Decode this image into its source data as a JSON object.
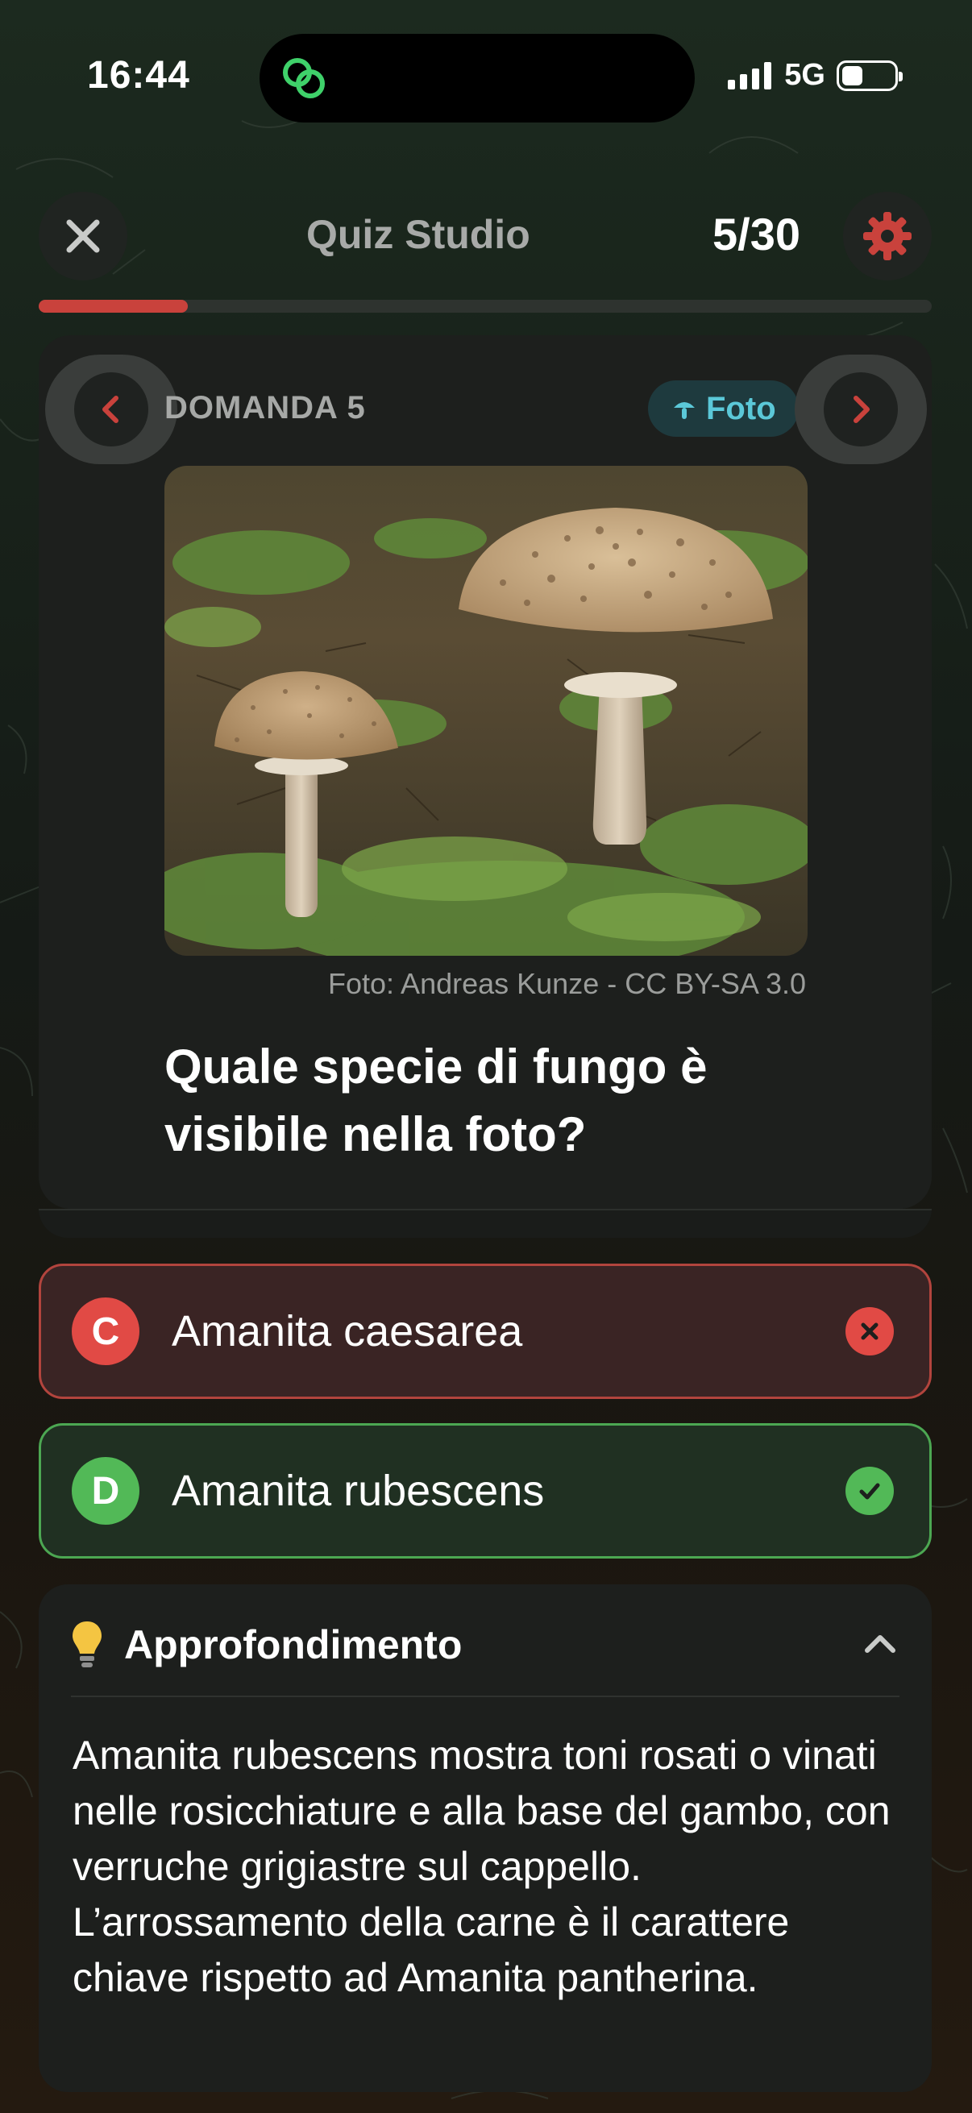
{
  "status_bar": {
    "time": "16:44",
    "network": "5G",
    "island_icon": "link-chain-icon"
  },
  "header": {
    "title": "Quiz Studio",
    "counter": "5/30",
    "close_icon": "close-icon",
    "settings_icon": "gear-icon",
    "progress": 0.167,
    "accent_color": "#c9423c"
  },
  "question_card": {
    "label": "DOMANDA 5",
    "badge": "Foto",
    "badge_icon": "mushroom-icon",
    "photo_credit": "Foto: Andreas Kunze - CC BY-SA 3.0",
    "question": "Quale specie di fungo è visibile nella foto?"
  },
  "answers": [
    {
      "letter": "C",
      "text": "Amanita caesarea",
      "state": "wrong",
      "color": "#e14a45"
    },
    {
      "letter": "D",
      "text": "Amanita rubescens",
      "state": "correct",
      "color": "#52b957"
    }
  ],
  "insight": {
    "icon": "lightbulb-icon",
    "title": "Approfondimento",
    "text": "Amanita rubescens mostra toni rosati o vinati nelle rosicchiature e alla base del gambo, con verruche grigiastre sul cappello. L’arrossamento della carne è il carattere chiave rispetto ad Amanita pantherina."
  }
}
